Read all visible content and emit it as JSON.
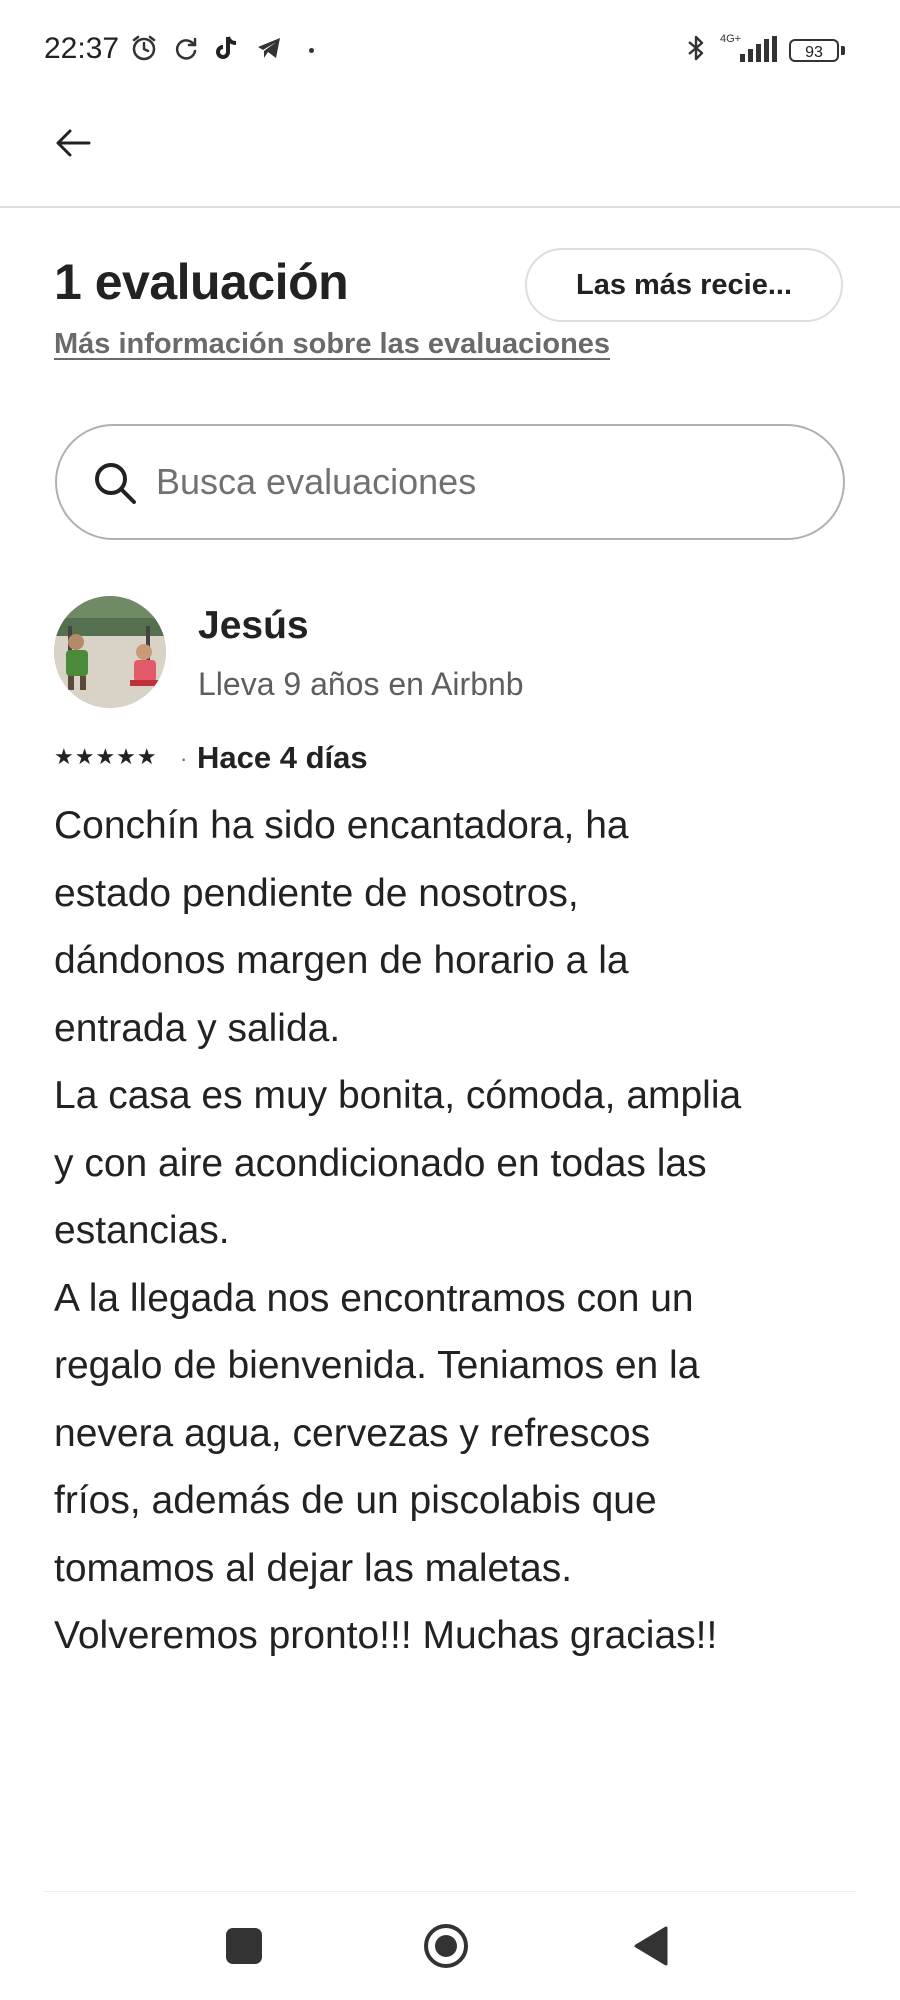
{
  "status_bar": {
    "time": "22:37",
    "network": "4G+",
    "battery": "93",
    "icons": [
      "alarm-icon",
      "sync-icon",
      "tiktok-icon",
      "telegram-icon",
      "bluetooth-icon",
      "signal-icon",
      "battery-icon"
    ]
  },
  "header": {
    "back_icon": "arrow-left-icon"
  },
  "reviews_header": {
    "title": "1 evaluación",
    "sort_label": "Las más recie...",
    "info_link": "Más información sobre las evaluaciones"
  },
  "search": {
    "placeholder": "Busca evaluaciones",
    "value": ""
  },
  "review": {
    "name": "Jesús",
    "tenure": "Lleva 9 años en Airbnb",
    "stars": "★★★★★",
    "rating": 5,
    "separator": "·",
    "date": "Hace 4 días",
    "lines": [
      "Conchín ha sido encantadora, ha",
      "estado pendiente de nosotros,",
      "dándonos margen de horario a la",
      "entrada y salida.",
      "La casa es muy bonita, cómoda, amplia",
      "y con aire acondicionado en todas las",
      "estancias.",
      "A la llegada nos encontramos con un",
      "regalo de bienvenida.  Teniamos en la",
      "nevera agua, cervezas y refrescos",
      "fríos, además de un piscolabis que",
      "tomamos al dejar las maletas.",
      "Volveremos pronto!!! Muchas gracias!!"
    ]
  },
  "colors": {
    "text": "#222222",
    "muted": "#717171",
    "border": "#dddddd",
    "background": "#ffffff"
  }
}
